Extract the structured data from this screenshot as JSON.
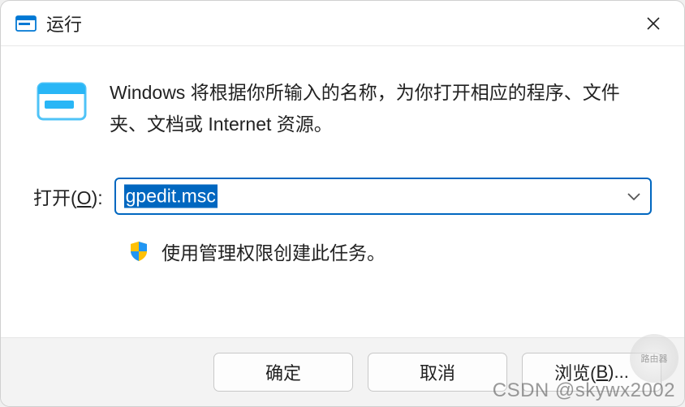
{
  "titlebar": {
    "title": "运行"
  },
  "body": {
    "description": "Windows 将根据你所输入的名称，为你打开相应的程序、文件夹、文档或 Internet 资源。",
    "open_label_prefix": "打开(",
    "open_label_key": "O",
    "open_label_suffix": "):",
    "input_value": "gpedit.msc",
    "admin_notice": "使用管理权限创建此任务。"
  },
  "buttons": {
    "ok": "确定",
    "cancel": "取消",
    "browse_prefix": "浏览(",
    "browse_key": "B",
    "browse_suffix": ")..."
  },
  "watermark": {
    "text": "CSDN @skywx2002",
    "logo_text": "路由器"
  }
}
